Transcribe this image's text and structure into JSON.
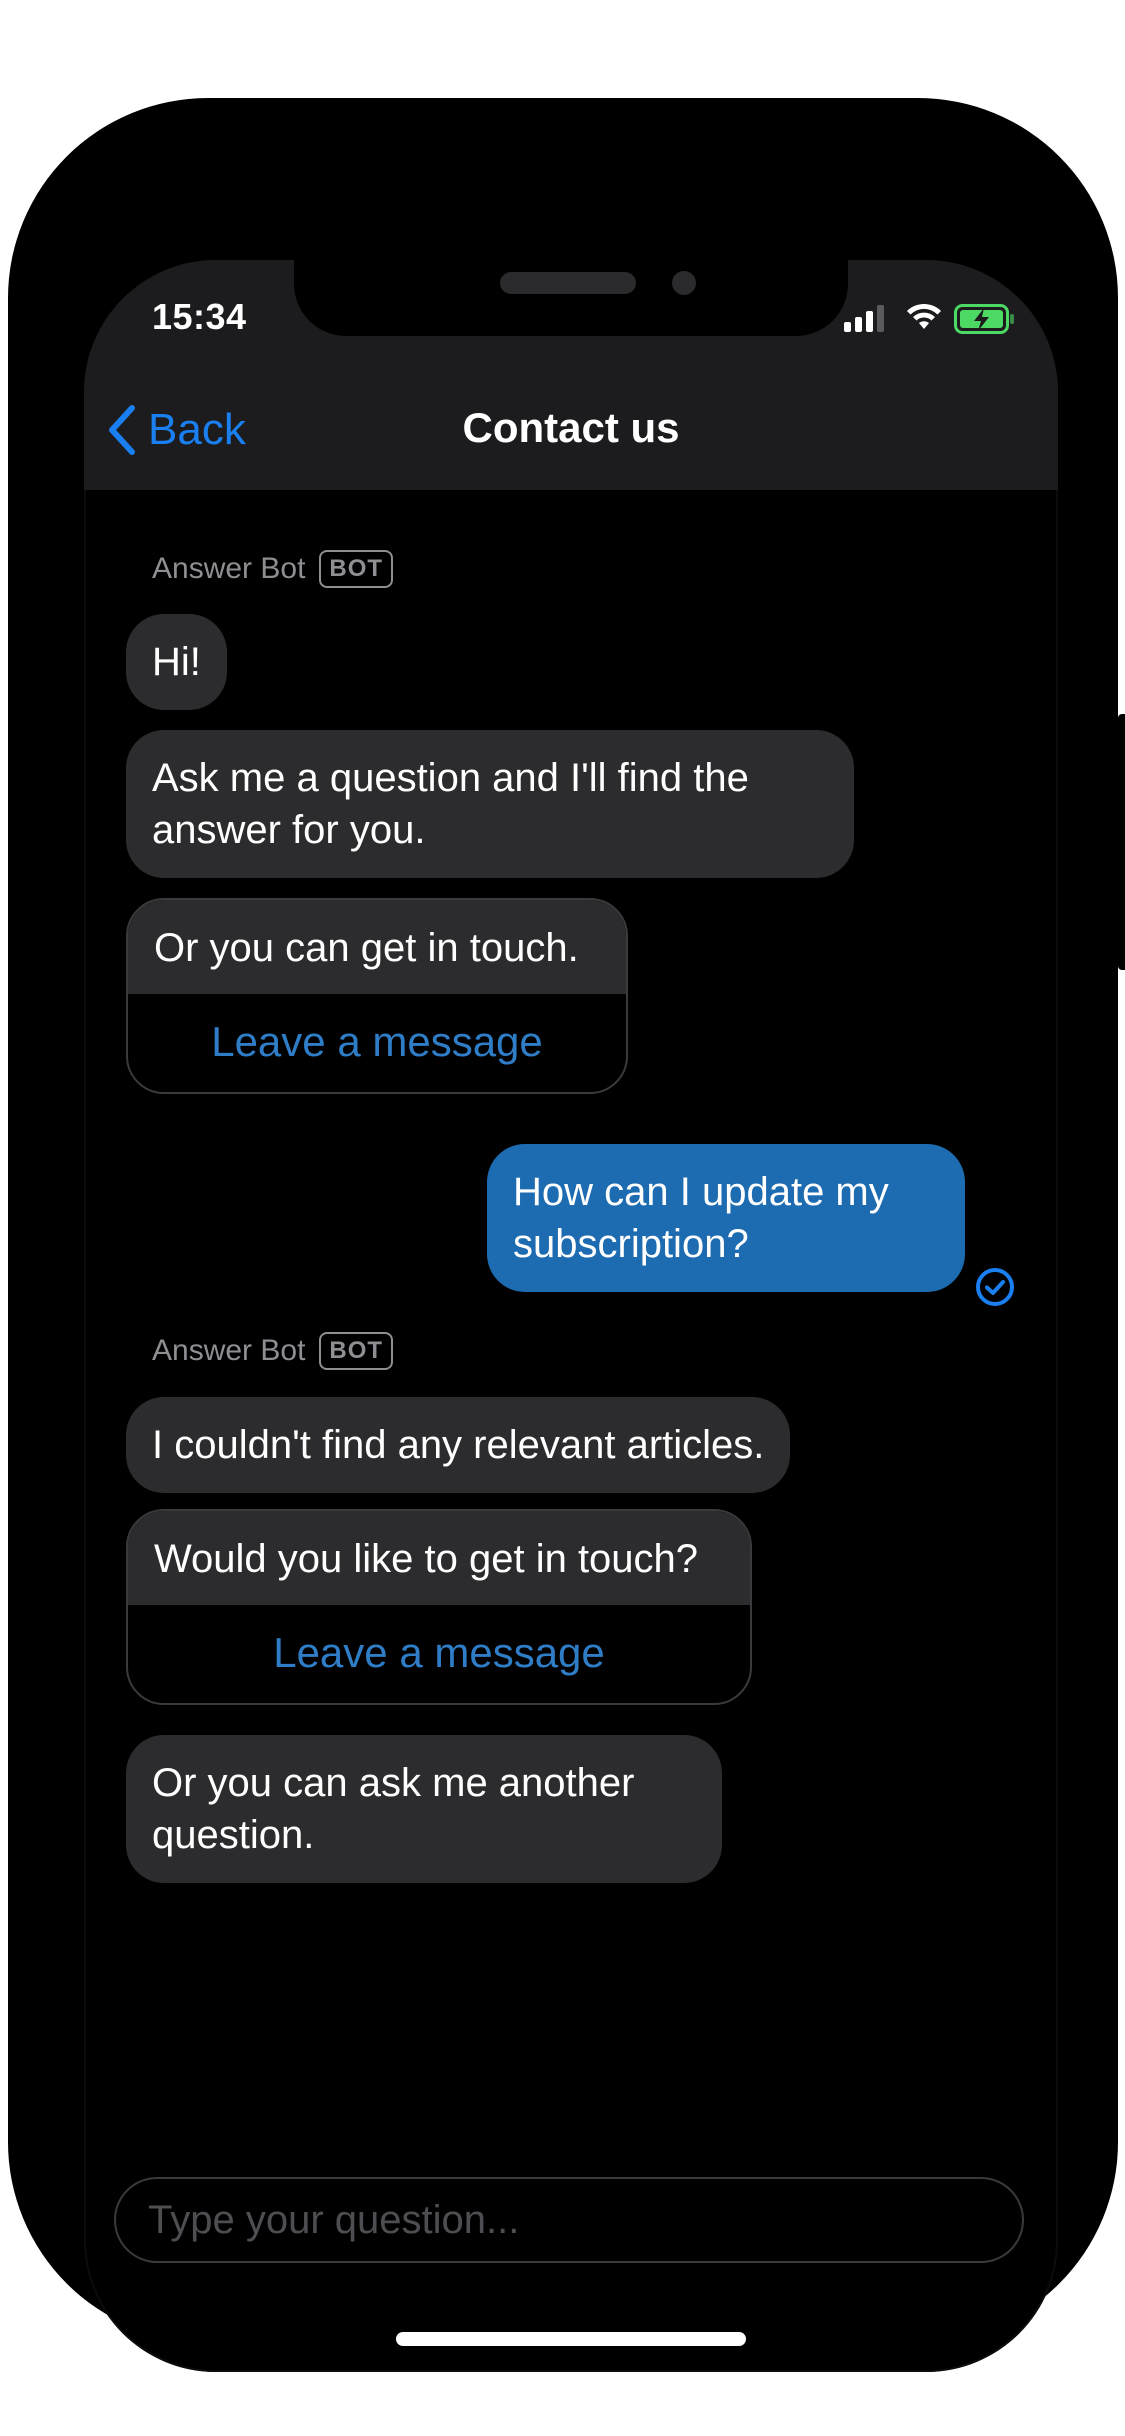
{
  "status_bar": {
    "time": "15:34",
    "icons": [
      "signal-icon",
      "wifi-icon",
      "battery-charging-icon"
    ]
  },
  "nav": {
    "back_label": "Back",
    "title": "Contact us"
  },
  "messages": {
    "group1": {
      "sender": "Answer Bot",
      "badge": "BOT",
      "bubble1": "Hi!",
      "bubble2": "Ask me a question and I'll find the answer for you.",
      "card": {
        "text": "Or you can get in touch.",
        "action": "Leave a message"
      }
    },
    "user": {
      "text": "How can I update my subscription?",
      "status_icon": "delivered-check-icon"
    },
    "group2": {
      "sender": "Answer Bot",
      "badge": "BOT",
      "bubble1": "I couldn't find any relevant articles.",
      "card": {
        "text": "Would you like to get in touch?",
        "action": "Leave a message"
      },
      "bubble2": "Or you can ask me another question."
    }
  },
  "composer": {
    "placeholder": "Type your question..."
  },
  "colors": {
    "accent": "#1a7ff0",
    "user_bubble": "#1d6bb0",
    "bot_bubble": "#2c2c2e",
    "action_link": "#2f7dc7",
    "battery": "#4cd964"
  }
}
